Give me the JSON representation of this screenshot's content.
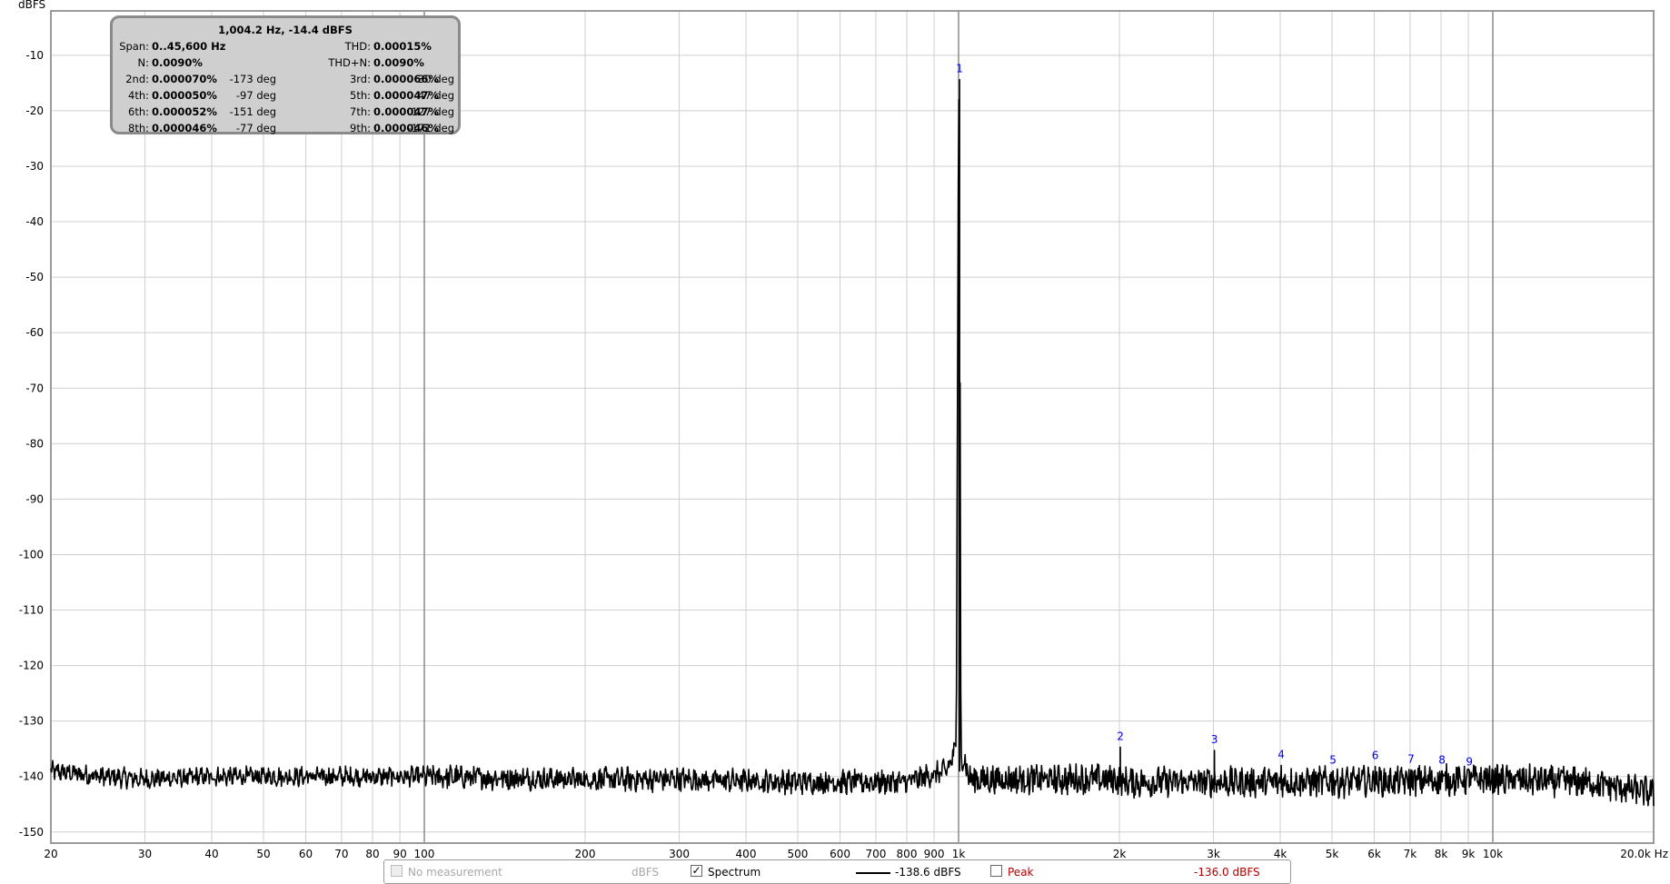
{
  "chart_data": {
    "type": "line",
    "y_unit_label": "dBFS",
    "x_unit_label": "Hz",
    "x_scale": "log",
    "xlim": [
      20,
      20000
    ],
    "ylim": [
      -152,
      -2
    ],
    "grid": true,
    "y_ticks": [
      -10,
      -20,
      -30,
      -40,
      -50,
      -60,
      -70,
      -80,
      -90,
      -100,
      -110,
      -120,
      -130,
      -140,
      -150
    ],
    "x_ticks": [
      {
        "v": 20,
        "label": "20"
      },
      {
        "v": 30,
        "label": "30"
      },
      {
        "v": 40,
        "label": "40"
      },
      {
        "v": 50,
        "label": "50"
      },
      {
        "v": 60,
        "label": "60"
      },
      {
        "v": 70,
        "label": "70"
      },
      {
        "v": 80,
        "label": "80"
      },
      {
        "v": 90,
        "label": "90"
      },
      {
        "v": 100,
        "label": "100"
      },
      {
        "v": 200,
        "label": "200"
      },
      {
        "v": 300,
        "label": "300"
      },
      {
        "v": 400,
        "label": "400"
      },
      {
        "v": 500,
        "label": "500"
      },
      {
        "v": 600,
        "label": "600"
      },
      {
        "v": 700,
        "label": "700"
      },
      {
        "v": 800,
        "label": "800"
      },
      {
        "v": 900,
        "label": "900"
      },
      {
        "v": 1000,
        "label": "1k"
      },
      {
        "v": 2000,
        "label": "2k"
      },
      {
        "v": 3000,
        "label": "3k"
      },
      {
        "v": 4000,
        "label": "4k"
      },
      {
        "v": 5000,
        "label": "5k"
      },
      {
        "v": 6000,
        "label": "6k"
      },
      {
        "v": 7000,
        "label": "7k"
      },
      {
        "v": 8000,
        "label": "8k"
      },
      {
        "v": 9000,
        "label": "9k"
      },
      {
        "v": 10000,
        "label": "10k"
      },
      {
        "v": 20000,
        "label": "20.0k Hz"
      }
    ],
    "series": [
      {
        "name": "Spectrum",
        "color": "#000000",
        "noise_floor_dbfs": -140.5,
        "x": [
          20,
          25,
          30,
          40,
          50,
          60,
          70,
          80,
          90,
          100,
          200,
          300,
          500,
          800,
          950,
          990,
          1000,
          1004.2,
          1010,
          1050,
          2000,
          2020,
          3000,
          3020,
          5000,
          10000,
          15000,
          20000
        ],
        "y": [
          -139,
          -140,
          -140.5,
          -140,
          -140,
          -140,
          -140,
          -140,
          -140,
          -140,
          -140.5,
          -140.5,
          -141,
          -141,
          -139,
          -135,
          -20,
          -14.4,
          -135,
          -140.5,
          -140.5,
          -141,
          -141,
          -141,
          -141,
          -140.5,
          -141,
          -143
        ]
      }
    ],
    "harmonics": [
      {
        "label": "1",
        "freq": 1004.2,
        "level": -14.4
      },
      {
        "label": "2",
        "freq": 2008,
        "level": -134.7
      },
      {
        "label": "3",
        "freq": 3012,
        "level": -135.3
      },
      {
        "label": "4",
        "freq": 4017,
        "level": -138.0
      },
      {
        "label": "5",
        "freq": 5021,
        "level": -139.0
      },
      {
        "label": "6",
        "freq": 6025,
        "level": -138.2
      },
      {
        "label": "7",
        "freq": 7029,
        "level": -138.8
      },
      {
        "label": "8",
        "freq": 8034,
        "level": -139.0
      },
      {
        "label": "9",
        "freq": 9038,
        "level": -139.3
      }
    ]
  },
  "summary": {
    "headline": "1,004.2 Hz, -14.4 dBFS",
    "span_label": "Span:",
    "span_value": "0..45,600 Hz",
    "thd_label": "THD:",
    "thd_value": "0.00015%",
    "n_label": "N:",
    "n_value": "0.0090%",
    "thdn_label": "THD+N:",
    "thdn_value": "0.0090%",
    "h2_label": "2nd:",
    "h2_value": "0.000070%",
    "h2_phase": "-173 deg",
    "h3_label": "3rd:",
    "h3_value": "0.000066%",
    "h3_phase": "30 deg",
    "h4_label": "4th:",
    "h4_value": "0.000050%",
    "h4_phase": "-97 deg",
    "h5_label": "5th:",
    "h5_value": "0.000047%",
    "h5_phase": "47 deg",
    "h6_label": "6th:",
    "h6_value": "0.000052%",
    "h6_phase": "-151 deg",
    "h7_label": "7th:",
    "h7_value": "0.000047%",
    "h7_phase": "127 deg",
    "h8_label": "8th:",
    "h8_value": "0.000046%",
    "h8_phase": "-77 deg",
    "h9_label": "9th:",
    "h9_value": "0.000046%",
    "h9_phase": "-171 deg"
  },
  "legend": {
    "no_measurement": "No measurement",
    "no_measurement_unit": "dBFS",
    "spectrum_label": "Spectrum",
    "spectrum_checked": "✓",
    "spectrum_value": "-138.6 dBFS",
    "peak_label": "Peak",
    "peak_value": "-136.0 dBFS"
  }
}
